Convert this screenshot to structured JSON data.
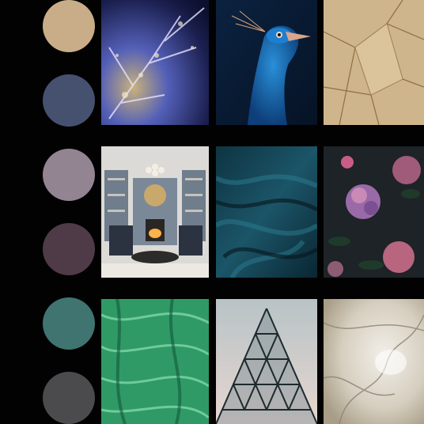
{
  "palette": {
    "swatches": [
      {
        "name": "sand",
        "color": "#c8ad88"
      },
      {
        "name": "navy",
        "color": "#45516f"
      },
      {
        "name": "mauve-gray",
        "color": "#938492"
      },
      {
        "name": "plum",
        "color": "#4f3b47"
      },
      {
        "name": "teal",
        "color": "#3f7470"
      },
      {
        "name": "charcoal",
        "color": "#4b4b4d"
      }
    ]
  },
  "moodboard": {
    "images": [
      {
        "subject": "crystal-frost-branches",
        "accent": "#2b3f8f"
      },
      {
        "subject": "peacock-head",
        "accent": "#1f63b5"
      },
      {
        "subject": "cracked-gold-leaf",
        "accent": "#c9b082"
      },
      {
        "subject": "blue-gray-living-room-with-fireplace",
        "accent": "#7a8796"
      },
      {
        "subject": "dark-teal-satin-fabric",
        "accent": "#143f4e"
      },
      {
        "subject": "pink-hydrangeas-on-dark",
        "accent": "#b0607f"
      },
      {
        "subject": "green-malachite-stone",
        "accent": "#3fae7a"
      },
      {
        "subject": "glass-pyramid-structure",
        "accent": "#2f4a52"
      },
      {
        "subject": "onyx-marble-texture",
        "accent": "#d7d0c2"
      }
    ]
  }
}
